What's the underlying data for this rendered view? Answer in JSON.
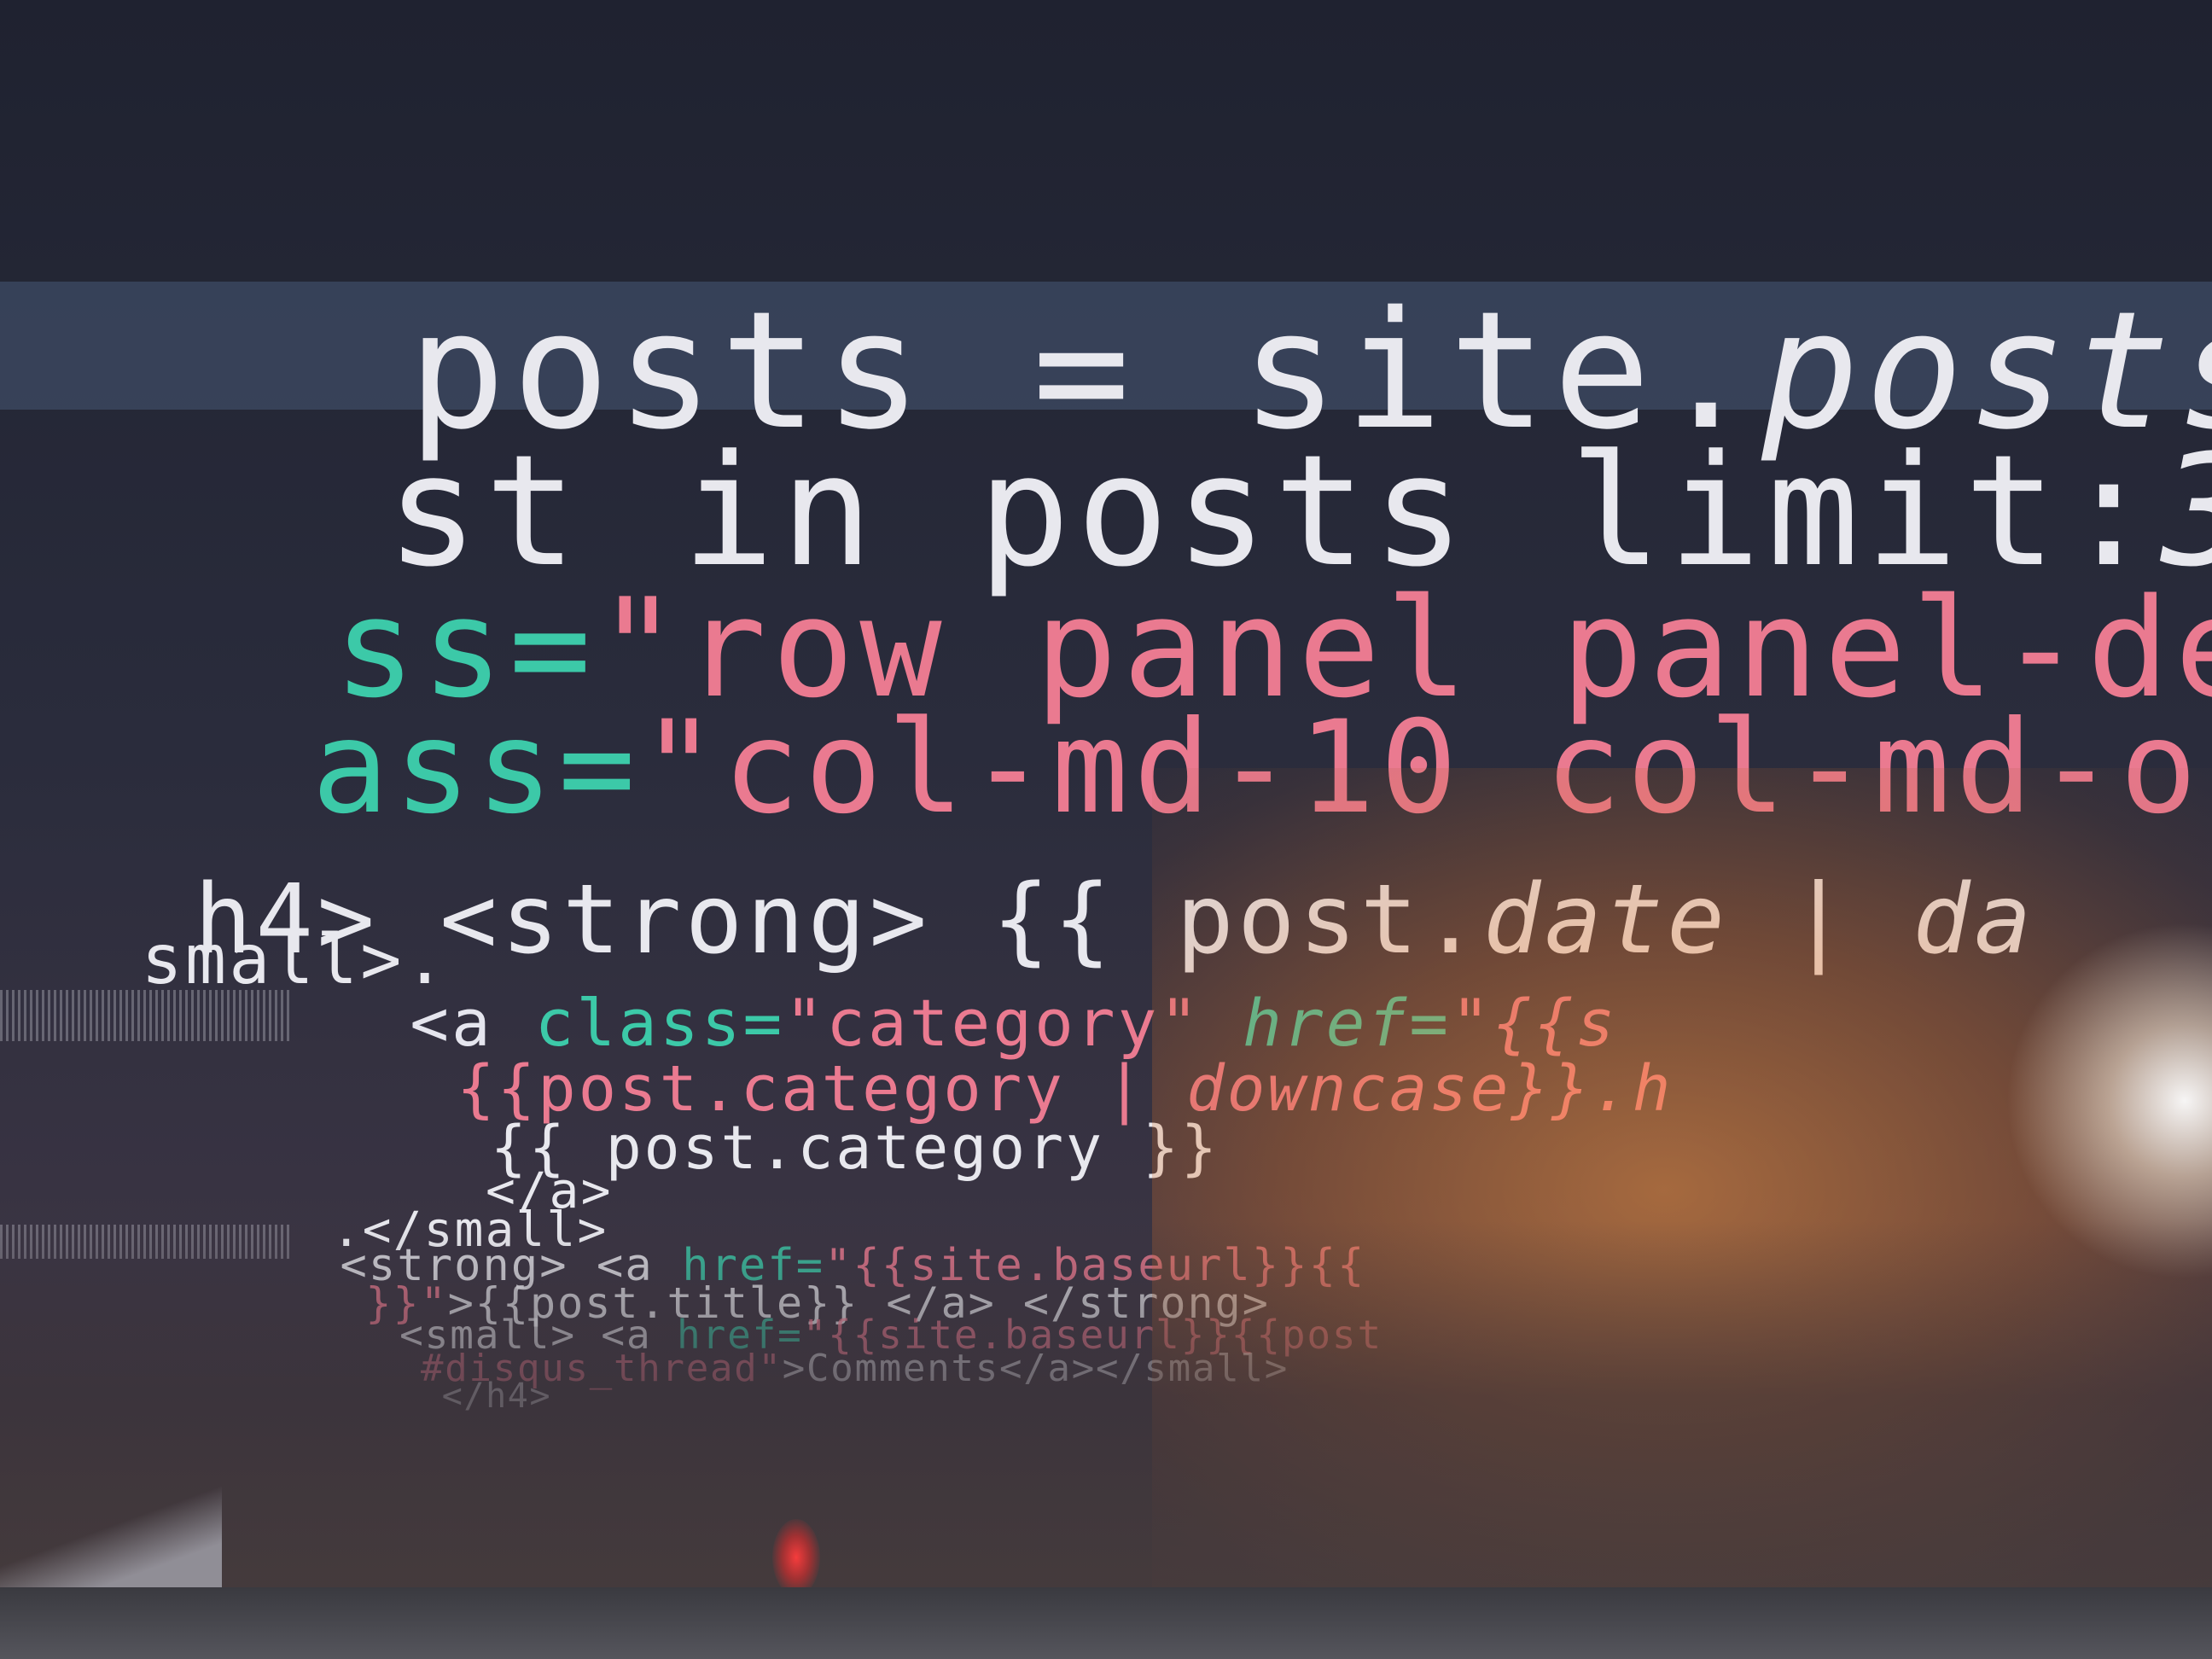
{
  "editor": {
    "lines": [
      {
        "text1": "posts = site.",
        "text2": "posts",
        "text3": " %}"
      },
      {
        "text1": "st in posts limit:",
        "text2": "3 %}"
      },
      {
        "attr": "ss=",
        "str": "\"row panel panel-defau"
      },
      {
        "attr": "ass=",
        "str": "\"col-md-10 col-md-offse"
      },
      {
        "text1": "h4> <strong> {{ post.",
        "text2": "date | da"
      },
      {
        "text1": "small>."
      },
      {
        "tag": "<a ",
        "attr": "class=",
        "str": "\"category\"",
        "attr2": " href=",
        "str2": "\"{{s"
      },
      {
        "str": "{{post.category | ",
        "str_it": "downcase}}.h"
      },
      {
        "text1": "{{ post.category }}"
      },
      {
        "text1": "</a>"
      },
      {
        "text1": ".</small>"
      },
      {
        "tag": "<strong> <a ",
        "attr": "href=",
        "str": "\"{{site.baseurl}}{{"
      },
      {
        "str": "}}\"",
        "text1": ">{{post.title}} </a> </strong>"
      },
      {
        "tag": "<small> <a ",
        "attr": "href=",
        "str": "\"{{site.baseurl}}{{post"
      },
      {
        "str": "#disqus_thread\"",
        "text1": ">Comments</a></small>"
      },
      {
        "text1": "</h4>"
      }
    ]
  }
}
